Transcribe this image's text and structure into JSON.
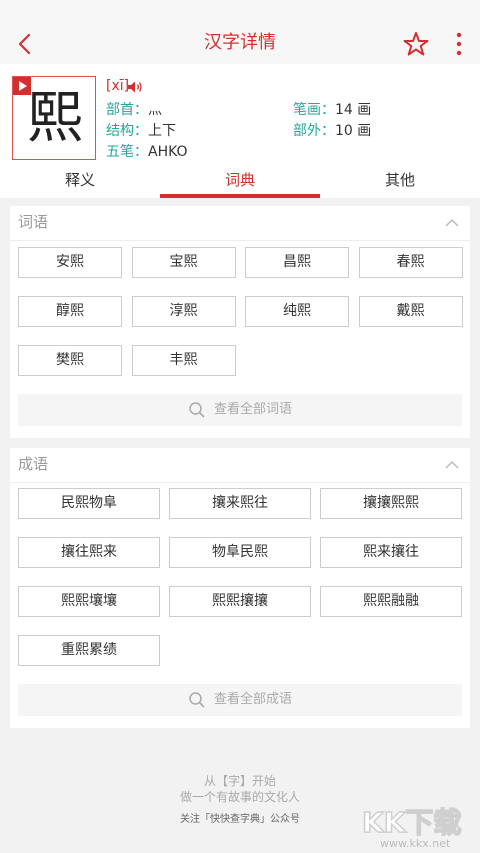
{
  "header": {
    "title": "汉字详情"
  },
  "character": {
    "glyph": "熙",
    "pinyin": "[xī]",
    "fields": [
      {
        "key": "部首：",
        "value": "灬"
      },
      {
        "key": "笔画：",
        "value": "14 画"
      },
      {
        "key": "结构：",
        "value": "上下"
      },
      {
        "key": "部外：",
        "value": "10 画"
      },
      {
        "key": "五笔：",
        "value": "AHKO"
      }
    ]
  },
  "tabs": [
    {
      "label": "释义",
      "active": false
    },
    {
      "label": "词典",
      "active": true
    },
    {
      "label": "其他",
      "active": false
    }
  ],
  "ciyu": {
    "title": "词语",
    "items": [
      "安熙",
      "宝熙",
      "昌熙",
      "春熙",
      "醇熙",
      "淳熙",
      "纯熙",
      "戴熙",
      "樊熙",
      "丰熙"
    ],
    "more": "查看全部词语"
  },
  "chengyu": {
    "title": "成语",
    "items": [
      "民熙物阜",
      "攘来熙往",
      "攘攘熙熙",
      "攘往熙来",
      "物阜民熙",
      "熙来攘往",
      "熙熙壤壤",
      "熙熙攘攘",
      "熙熙融融",
      "重熙累绩"
    ],
    "more": "查看全部成语"
  },
  "footer": {
    "line1": "从【字】开始",
    "line2": "做一个有故事的文化人",
    "line3": "关注「快快查字典」公众号"
  },
  "watermark": {
    "brand": "KK下载",
    "url": "www.kkx.net"
  },
  "colors": {
    "accent": "#d32f2f",
    "teal": "#26a69a"
  },
  "icons": [
    "back-arrow-icon",
    "star-icon",
    "more-vertical-icon",
    "play-icon",
    "speaker-icon",
    "chevron-up-icon",
    "search-icon"
  ]
}
